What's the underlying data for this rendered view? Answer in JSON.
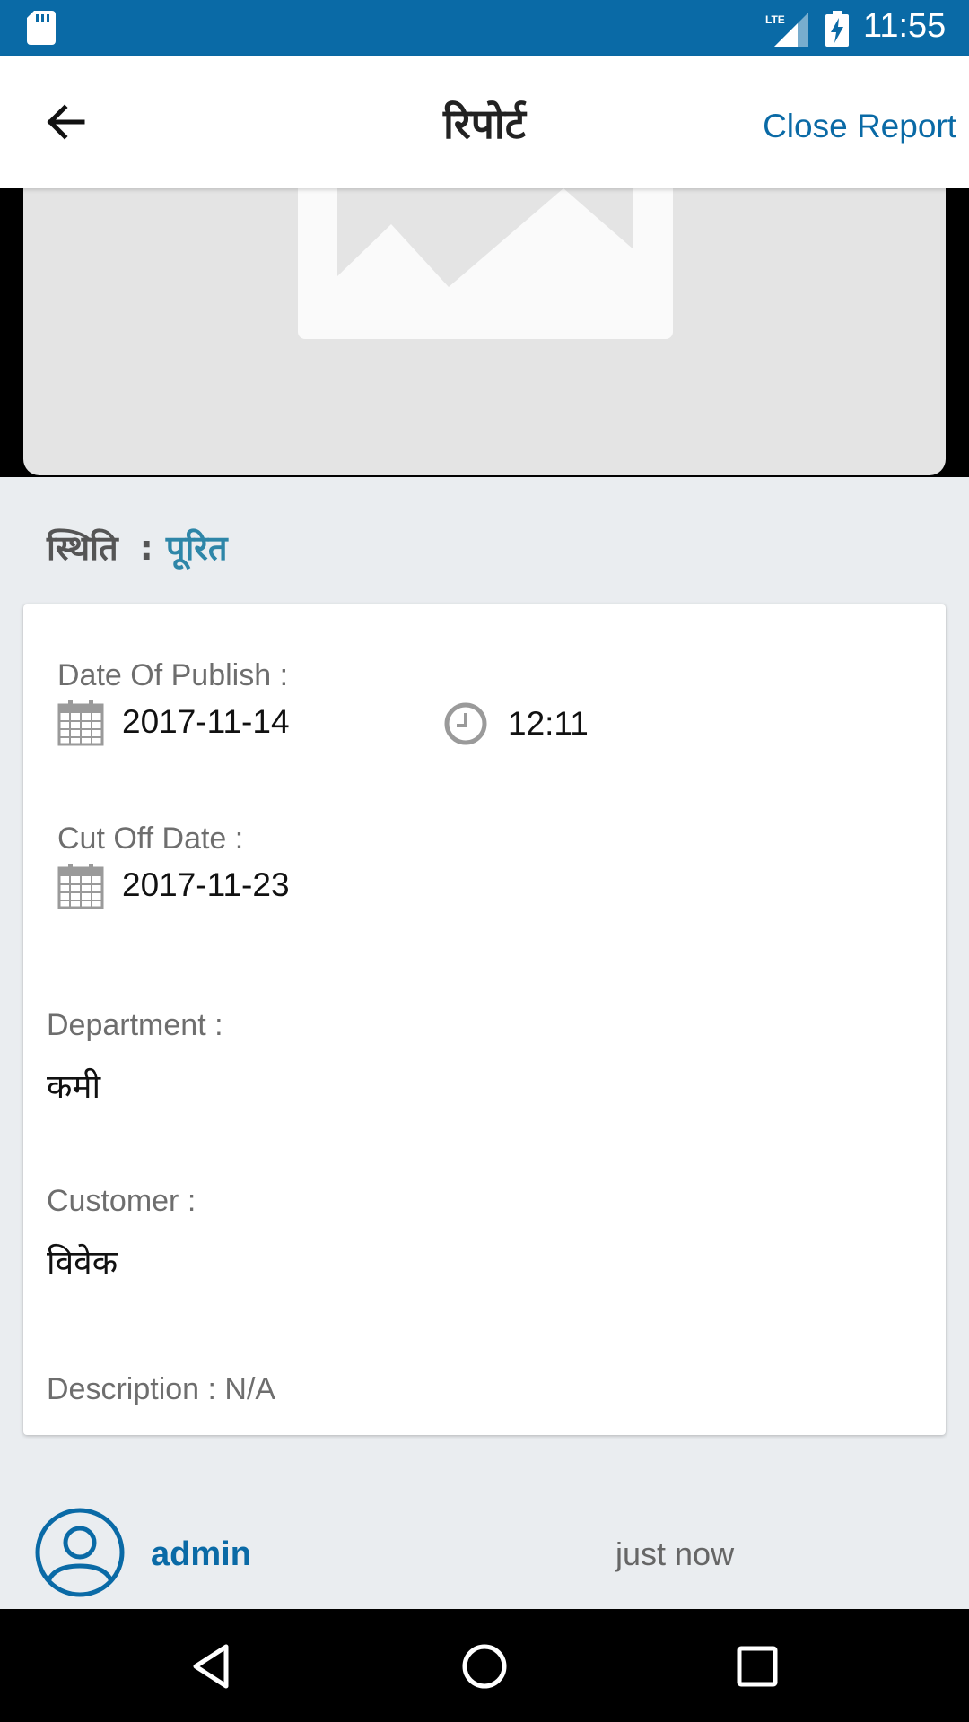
{
  "status_bar": {
    "time": "11:55",
    "network": "LTE"
  },
  "app_bar": {
    "title": "रिपोर्ट",
    "close_label": "Close Report"
  },
  "report_status": {
    "label": "स्थिति",
    "separator": ":",
    "value": "पूरित"
  },
  "details": {
    "publish_label": "Date Of Publish :",
    "publish_date": "2017-11-14",
    "publish_time": "12:11",
    "cutoff_label": "Cut Off Date :",
    "cutoff_date": "2017-11-23",
    "department_label": "Department :",
    "department_value": "कमी",
    "customer_label": "Customer :",
    "customer_value": "विवेक",
    "description": "Description : N/A"
  },
  "comment": {
    "user": "admin",
    "time": "just now"
  },
  "colors": {
    "primary": "#0a6aa6",
    "status_value": "#2e86a8",
    "background": "#eaedf0"
  }
}
